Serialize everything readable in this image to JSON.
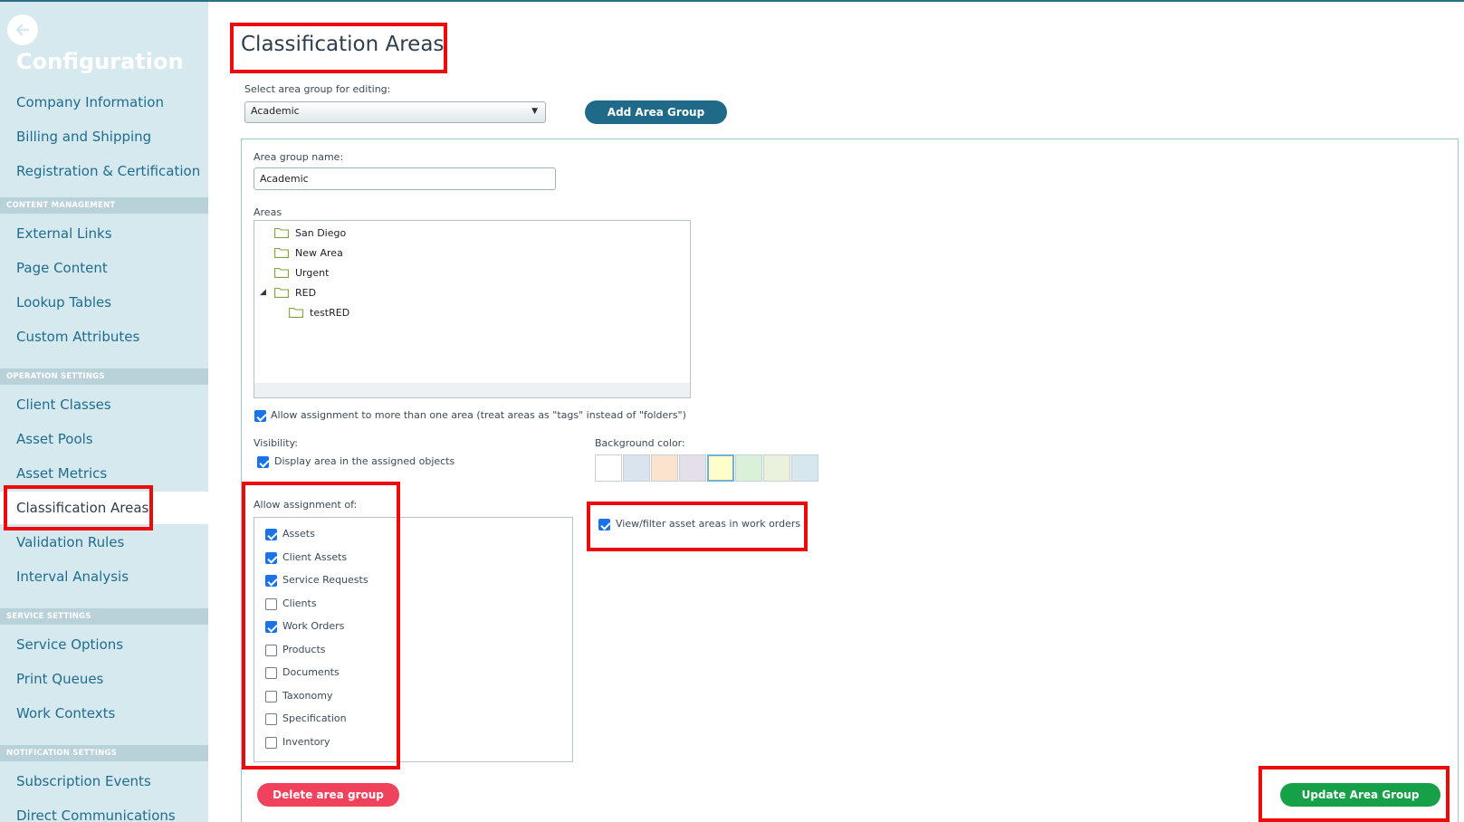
{
  "sidebar": {
    "title": "Configuration",
    "items": [
      {
        "label": "Company Information"
      },
      {
        "label": "Billing and Shipping"
      },
      {
        "label": "Registration & Certification"
      },
      {
        "label": "External Links"
      },
      {
        "label": "Page Content"
      },
      {
        "label": "Lookup Tables"
      },
      {
        "label": "Custom Attributes"
      },
      {
        "label": "Client Classes"
      },
      {
        "label": "Asset Pools"
      },
      {
        "label": "Asset Metrics"
      },
      {
        "label": "Classification Areas",
        "active": true
      },
      {
        "label": "Validation Rules"
      },
      {
        "label": "Interval Analysis"
      },
      {
        "label": "Service Options"
      },
      {
        "label": "Print Queues"
      },
      {
        "label": "Work Contexts"
      },
      {
        "label": "Subscription Events"
      },
      {
        "label": "Direct Communications"
      }
    ],
    "sections": [
      {
        "label": "CONTENT MANAGEMENT"
      },
      {
        "label": "OPERATION SETTINGS"
      },
      {
        "label": "SERVICE SETTINGS"
      },
      {
        "label": "NOTIFICATION SETTINGS"
      }
    ]
  },
  "main": {
    "title": "Classification Areas",
    "select_label": "Select area group for editing:",
    "select_value": "Academic",
    "add_button": "Add Area Group",
    "group_name_label": "Area group name:",
    "group_name_value": "Academic",
    "areas_label": "Areas",
    "areas": [
      {
        "label": "San Diego"
      },
      {
        "label": "New Area"
      },
      {
        "label": "Urgent"
      },
      {
        "label": "RED",
        "expanded": true
      },
      {
        "label": "testRED",
        "parent": "RED"
      }
    ],
    "multi_assign_label": "Allow assignment to more than one area (treat areas as \"tags\" instead of \"folders\")",
    "multi_assign_checked": true,
    "visibility_label": "Visibility:",
    "display_area_label": "Display area in the assigned objects",
    "display_area_checked": true,
    "bg_color_label": "Background color:",
    "bg_colors": [
      "#ffffff",
      "#d9e4ef",
      "#fbe3cf",
      "#e5dfea",
      "#fffdc9",
      "#d9f1d9",
      "#eaf1dd",
      "#d6e7ee"
    ],
    "bg_color_selected": "#fffdc9",
    "allow_assignment_label": "Allow assignment of:",
    "assignments": [
      {
        "label": "Assets",
        "checked": true
      },
      {
        "label": "Client Assets",
        "checked": true
      },
      {
        "label": "Service Requests",
        "checked": true
      },
      {
        "label": "Clients",
        "checked": false
      },
      {
        "label": "Work Orders",
        "checked": true
      },
      {
        "label": "Products",
        "checked": false
      },
      {
        "label": "Documents",
        "checked": false
      },
      {
        "label": "Taxonomy",
        "checked": false
      },
      {
        "label": "Specification",
        "checked": false
      },
      {
        "label": "Inventory",
        "checked": false
      }
    ],
    "view_filter_label": "View/filter asset areas in work orders",
    "view_filter_checked": true,
    "delete_button": "Delete area group",
    "update_button": "Update Area Group"
  }
}
